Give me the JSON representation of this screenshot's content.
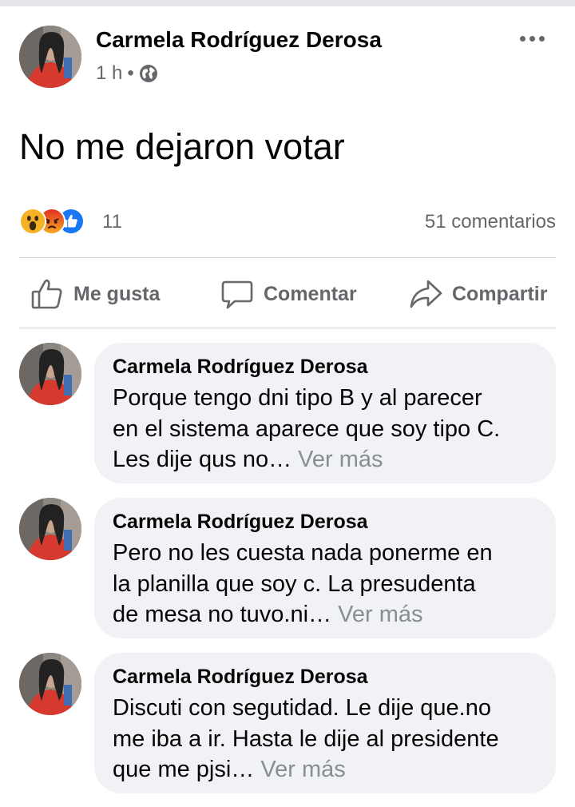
{
  "post": {
    "author": "Carmela Rodríguez Derosa",
    "time": "1 h",
    "separator": "•",
    "audience_icon": "globe-icon",
    "text": "No me dejaron votar",
    "menu_icon": "more-options-icon"
  },
  "reactions": {
    "types": [
      "wow",
      "angry",
      "like"
    ],
    "count": "11",
    "comments_label": "51 comentarios",
    "colors": {
      "wow": "#f7b125",
      "angry": "#e9710f",
      "like": "#1877f2"
    }
  },
  "actions": {
    "like_label": "Me gusta",
    "comment_label": "Comentar",
    "share_label": "Compartir"
  },
  "comments": [
    {
      "author": "Carmela Rodríguez Derosa",
      "lines": [
        "Porque tengo dni tipo B y al parecer",
        "en el sistema aparece que soy tipo C.",
        "Les dije qus no…"
      ],
      "see_more": "Ver más"
    },
    {
      "author": "Carmela Rodríguez Derosa",
      "lines": [
        "Pero no les cuesta nada ponerme en",
        "la planilla que soy c. La presudenta",
        "de mesa no tuvo.ni…"
      ],
      "see_more": "Ver más"
    },
    {
      "author": "Carmela Rodríguez Derosa",
      "lines": [
        "Discuti con segutidad. Le dije que.no",
        "me iba a ir. Hasta le dije al presidente",
        "que me pjsi…"
      ],
      "see_more": "Ver más"
    }
  ],
  "theme": {
    "text_primary": "#050505",
    "text_secondary": "#65676b",
    "bubble_bg": "#f0f2f5",
    "divider": "#ced0d4"
  }
}
